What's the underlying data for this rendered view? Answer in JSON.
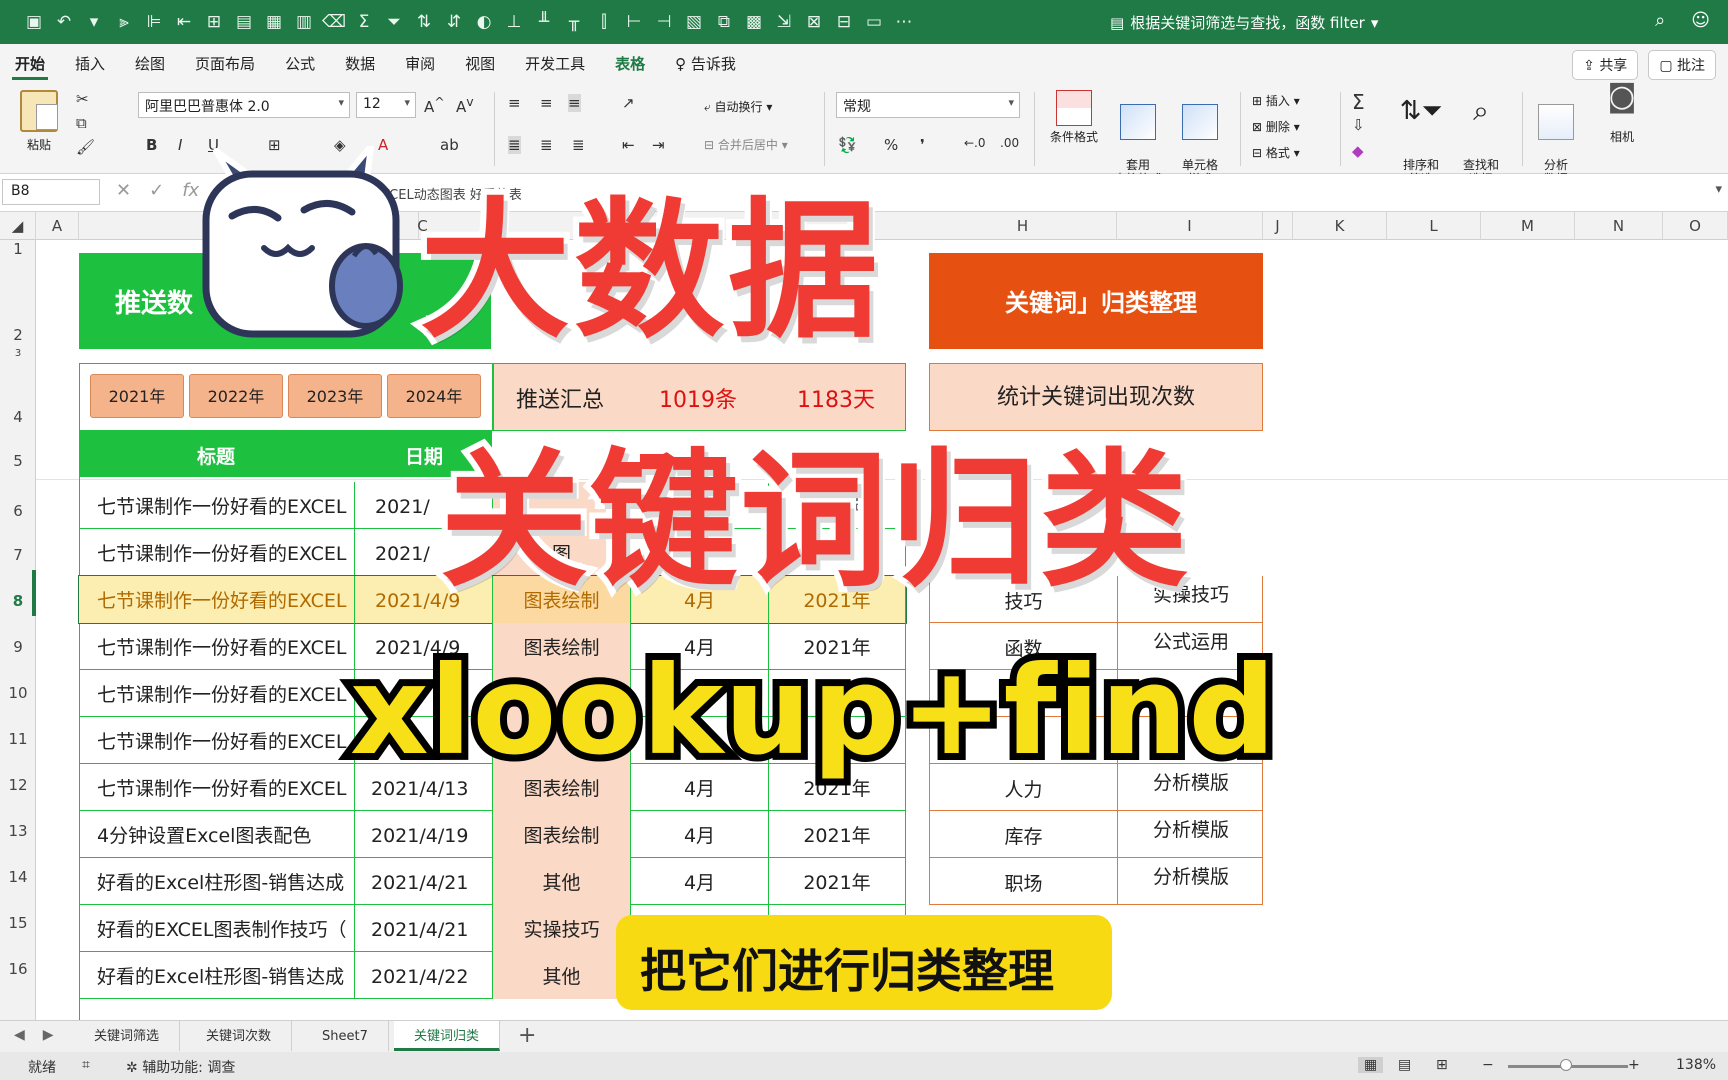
{
  "titlebar": {
    "doc_title": "根据关键词筛选与查找，函数 filter",
    "icons": [
      "save-icon",
      "undo-icon",
      "redo-icon",
      "sum-icon",
      "filter-icon",
      "sort-asc-icon",
      "sort-desc-icon",
      "more-icon"
    ]
  },
  "tabs": [
    "开始",
    "插入",
    "绘图",
    "页面布局",
    "公式",
    "数据",
    "审阅",
    "视图",
    "开发工具",
    "表格",
    "告诉我"
  ],
  "tab_buttons": {
    "share": "共享",
    "comment": "批注"
  },
  "ribbon": {
    "paste_label": "粘贴",
    "font_name": "阿里巴巴普惠体 2.0",
    "font_size": "12",
    "wrap_text": "自动换行",
    "merge_center": "合并后居中",
    "number_format": "常规",
    "conditional_format": "条件格式",
    "table_format": "套用\n表格格式",
    "cell_style": "单元格\n样式",
    "insert": "插入",
    "delete": "删除",
    "format": "格式",
    "sort_filter": "排序和\n筛选",
    "find_select": "查找和\n选择",
    "analyze": "分析\n数据",
    "camera": "相机"
  },
  "formula_bar": {
    "cell_ref": "B8",
    "formula_partial": "的EXCEL动态图表    好看的表"
  },
  "columns": [
    "A",
    "B",
    "C",
    "D",
    "E",
    "F",
    "G",
    "H",
    "I",
    "J",
    "K",
    "L",
    "M",
    "N",
    "O"
  ],
  "rows": [
    "1",
    "2",
    "3",
    "4",
    "5",
    "6",
    "7",
    "8",
    "9",
    "10",
    "11",
    "12",
    "13",
    "14",
    "15",
    "16"
  ],
  "sheet": {
    "banner_left": "推送数",
    "banner_right": "关键词」归类整理",
    "years": [
      "2021年",
      "2022年",
      "2023年",
      "2024年"
    ],
    "summary": [
      "推送汇总",
      "1019条",
      "1183天"
    ],
    "stat_title": "统计关键词出现次数",
    "header_title": "标题",
    "header_date": "日期",
    "data_rows": [
      {
        "title": "七节课制作一份好看的EXCEL",
        "date": "2021/",
        "cat": "",
        "month": "",
        "year": "2021年"
      },
      {
        "title": "七节课制作一份好看的EXCEL",
        "date": "2021/",
        "cat": "图",
        "month": "",
        "year": ""
      },
      {
        "title": "七节课制作一份好看的EXCEL",
        "date": "2021/4/9",
        "cat": "图表绘制",
        "month": "4月",
        "year": "2021年"
      },
      {
        "title": "七节课制作一份好看的EXCEL",
        "date": "2021/4/9",
        "cat": "图表绘制",
        "month": "4月",
        "year": "2021年"
      },
      {
        "title": "七节课制作一份好看的EXCEL",
        "date": "",
        "cat": "",
        "month": "",
        "year": ""
      },
      {
        "title": "七节课制作一份好看的EXCEL",
        "date": "",
        "cat": "",
        "month": "",
        "year": ""
      },
      {
        "title": "七节课制作一份好看的EXCEL",
        "date": "2021/4/13",
        "cat": "图表绘制",
        "month": "4月",
        "year": "2021年"
      },
      {
        "title": "4分钟设置Excel图表配色",
        "date": "2021/4/19",
        "cat": "图表绘制",
        "month": "4月",
        "year": "2021年"
      },
      {
        "title": "好看的Excel柱形图-销售达成",
        "date": "2021/4/21",
        "cat": "其他",
        "month": "4月",
        "year": "2021年"
      },
      {
        "title": "好看的EXCEL图表制作技巧（",
        "date": "2021/4/21",
        "cat": "实操技巧",
        "month": "",
        "year": ""
      },
      {
        "title": "好看的Excel柱形图-销售达成",
        "date": "2021/4/22",
        "cat": "其他",
        "month": "",
        "year": ""
      }
    ],
    "keywords": [
      {
        "kw": "技巧",
        "cat": "实操技巧"
      },
      {
        "kw": "函数",
        "cat": "公式运用"
      },
      {
        "kw": "",
        "cat": ""
      },
      {
        "kw": "",
        "cat": ""
      },
      {
        "kw": "人力",
        "cat": "分析模版"
      },
      {
        "kw": "库存",
        "cat": "分析模版"
      },
      {
        "kw": "职场",
        "cat": "分析模版"
      }
    ]
  },
  "overlay": {
    "line1": "大数据",
    "line2": "关键词归类",
    "line3": "xlookup+find",
    "caption": "把它们进行归类整理"
  },
  "sheet_tabs": [
    "关键词筛选",
    "关键词次数",
    "Sheet7",
    "关键词归类"
  ],
  "active_sheet": "关键词归类",
  "statusbar": {
    "ready": "就绪",
    "accessibility": "辅助功能: 调查",
    "zoom": "138%"
  }
}
